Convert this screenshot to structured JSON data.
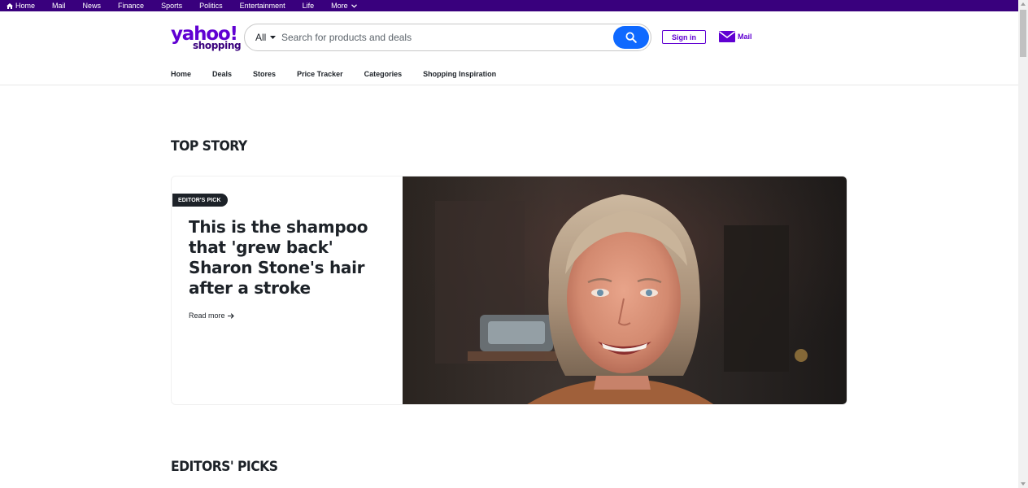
{
  "topbar": {
    "items": [
      {
        "label": "Home",
        "icon": "home-icon"
      },
      {
        "label": "Mail"
      },
      {
        "label": "News"
      },
      {
        "label": "Finance"
      },
      {
        "label": "Sports"
      },
      {
        "label": "Politics"
      },
      {
        "label": "Entertainment"
      },
      {
        "label": "Life"
      },
      {
        "label": "More",
        "icon": "chevron-down-icon"
      }
    ]
  },
  "header": {
    "logo_primary": "yahoo!",
    "logo_secondary": "shopping",
    "search": {
      "category": "All",
      "placeholder": "Search for products and deals"
    },
    "signin_label": "Sign in",
    "mail_label": "Mail"
  },
  "nav": {
    "items": [
      "Home",
      "Deals",
      "Stores",
      "Price Tracker",
      "Categories",
      "Shopping Inspiration"
    ]
  },
  "top_story": {
    "section_title": "TOP STORY",
    "badge": "EDITOR'S PICK",
    "headline": "This is the shampoo that 'grew back' Sharon Stone's hair after a stroke",
    "read_more": "Read more"
  },
  "editors_picks": {
    "section_title": "EDITORS' PICKS"
  },
  "colors": {
    "brand_purple": "#6001d2",
    "topbar_purple": "#39007d",
    "search_blue": "#0f69ff",
    "text_dark": "#1d2228"
  }
}
